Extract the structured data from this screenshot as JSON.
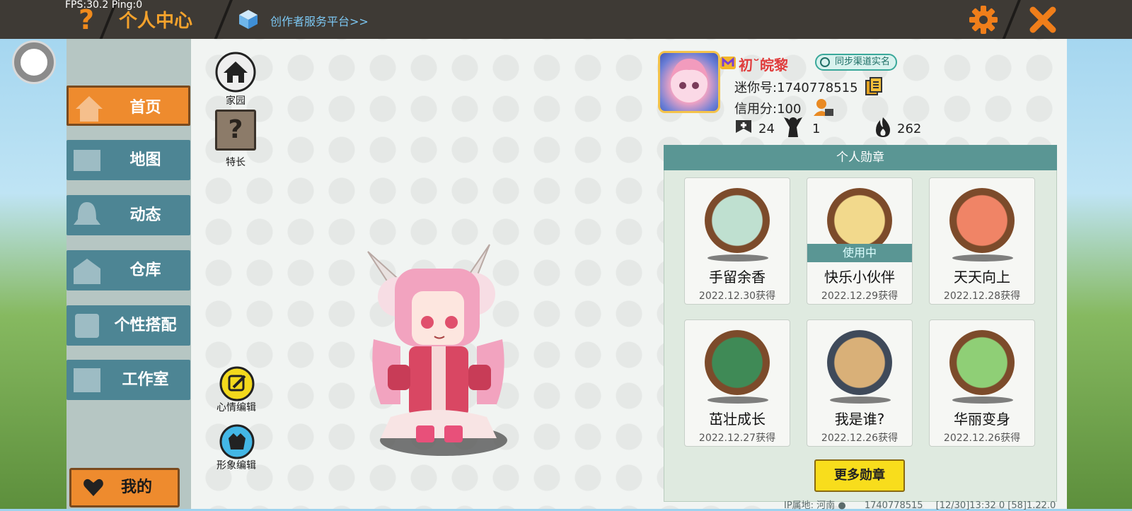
{
  "status": {
    "fps": "FPS:30.2  Ping:0"
  },
  "header": {
    "title": "个人中心",
    "creator_link": "创作者服务平台>>",
    "icons": [
      "help-icon",
      "settings-icon",
      "close-icon"
    ]
  },
  "sidebar": {
    "items": [
      {
        "label": "首页",
        "active": true
      },
      {
        "label": "地图"
      },
      {
        "label": "动态"
      },
      {
        "label": "仓库"
      },
      {
        "label": "个性搭配"
      },
      {
        "label": "工作室"
      }
    ],
    "mine_label": "我的"
  },
  "left_tools": {
    "home_label": "家园",
    "specialty_label": "特长",
    "specialty_glyph": "?",
    "mood_label": "心情编辑",
    "look_label": "形象编辑"
  },
  "profile": {
    "name": "初˘皖黎",
    "sync_label": "同步渠道实名",
    "mini_id": "迷你号:1740778515",
    "credit": "信用分:100",
    "added": "24",
    "fans": "1",
    "heat": "262"
  },
  "badges": {
    "header": "个人勋章",
    "items": [
      {
        "name": "手留余香",
        "date": "2022.12.30获得",
        "in_use": ""
      },
      {
        "name": "快乐小伙伴",
        "date": "2022.12.29获得",
        "in_use": "使用中"
      },
      {
        "name": "天天向上",
        "date": "2022.12.28获得",
        "in_use": ""
      },
      {
        "name": "茁壮成长",
        "date": "2022.12.27获得",
        "in_use": ""
      },
      {
        "name": "我是谁?",
        "date": "2022.12.26获得",
        "in_use": ""
      },
      {
        "name": "华丽变身",
        "date": "2022.12.26获得",
        "in_use": ""
      }
    ],
    "more_label": "更多勋章"
  },
  "footer": {
    "ip": "IP属地: 河南",
    "uid": "1740778515",
    "time": "[12/30]13:32 0",
    "version": "[58]1.22.0"
  },
  "colors": {
    "accent": "#ee8b2e",
    "teal": "#5a9694",
    "nav": "#4d8594"
  }
}
